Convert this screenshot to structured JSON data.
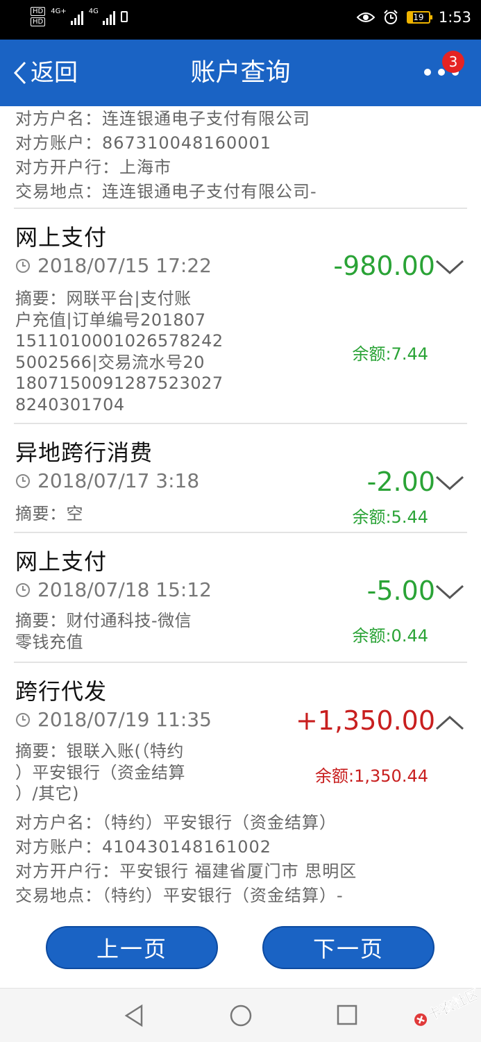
{
  "status_bar": {
    "hd1": "HD",
    "hd2": "HD",
    "net1": "4G+",
    "net2": "4G",
    "battery": "19",
    "time": "1:53"
  },
  "nav": {
    "back_label": "返回",
    "title": "账户查询",
    "badge": "3"
  },
  "prev_detail": [
    "对方户名：连连银通电子支付有限公司",
    "对方账户：867310048160001",
    "对方开户行：上海市",
    "交易地点：连连银通电子支付有限公司-"
  ],
  "transactions": [
    {
      "title": "网上支付",
      "time": "2018/07/15 17:22",
      "amount": "-980.00",
      "memo": [
        "摘要：网联平台|支付账",
        "户充值|订单编号201807",
        "1511010001026578242",
        "5002566|交易流水号20",
        "1807150091287523027",
        "8240301704"
      ],
      "balance": "余额:7.44"
    },
    {
      "title": "异地跨行消费",
      "time": "2018/07/17 3:18",
      "amount": "-2.00",
      "memo": [
        "摘要：空"
      ],
      "balance": "余额:5.44"
    },
    {
      "title": "网上支付",
      "time": "2018/07/18 15:12",
      "amount": "-5.00",
      "memo": [
        "摘要：财付通科技-微信",
        "零钱充值"
      ],
      "balance": "余额:0.44"
    },
    {
      "title": "跨行代发",
      "time": "2018/07/19 11:35",
      "amount": "+1,350.00",
      "memo": [
        "摘要：银联入账(（特约",
        "）平安银行（资金结算",
        "）/其它)"
      ],
      "balance": "余额:1,350.44",
      "details": [
        "对方户名：（特约）平安银行（资金结算）",
        "对方账户：410430148161002",
        "对方开户行：平安银行 福建省厦门市 思明区",
        "交易地点：（特约）平安银行（资金结算）-"
      ]
    }
  ],
  "pagination": {
    "prev": "上一页",
    "next": "下一页"
  },
  "colors": {
    "primary": "#1a63c4",
    "debit": "#2aa336",
    "credit": "#c81f1f",
    "badge": "#e52323"
  },
  "watermark": "卡农社区"
}
